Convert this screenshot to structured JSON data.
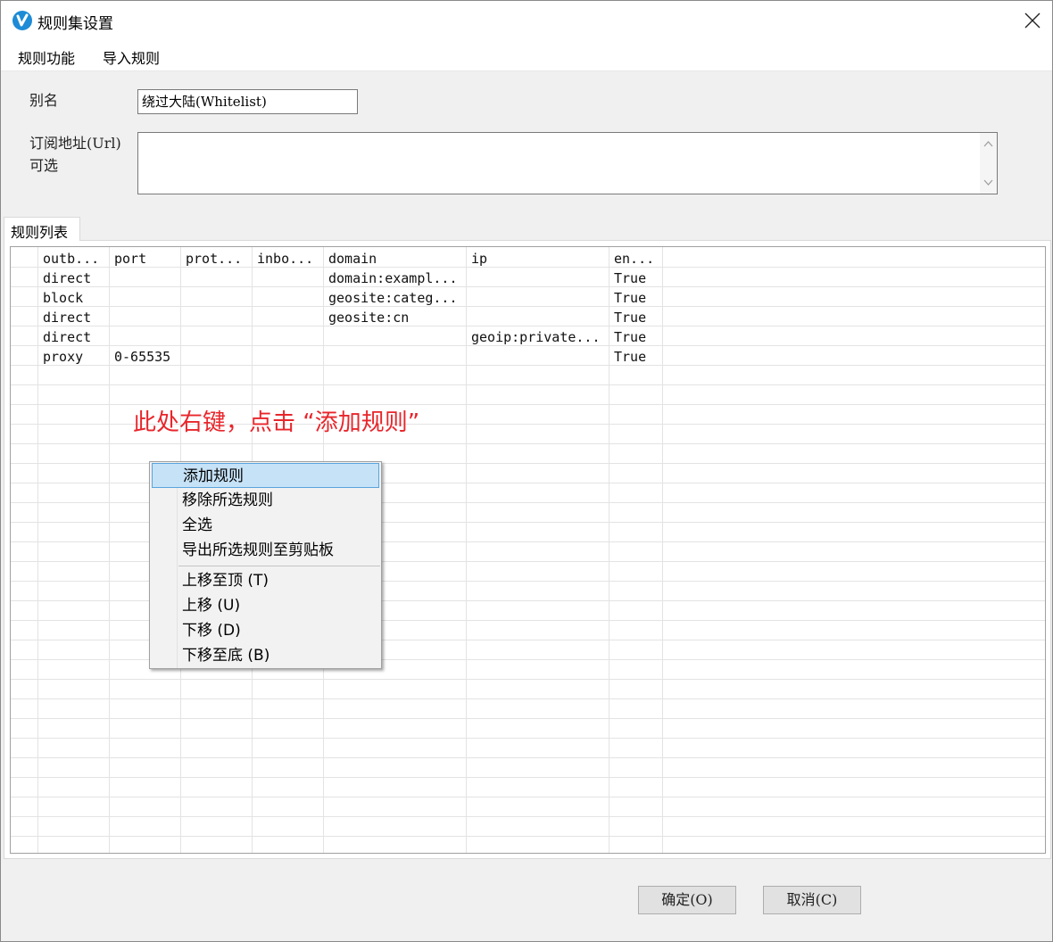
{
  "window": {
    "title": "规则集设置"
  },
  "menubar": {
    "items": [
      "规则功能",
      "导入规则"
    ]
  },
  "form": {
    "alias_label": "别名",
    "alias_value": "绕过大陆(Whitelist)",
    "url_label_line1": "订阅地址(Url)",
    "url_label_line2": "可选",
    "url_value": ""
  },
  "tab": {
    "label": "规则列表"
  },
  "grid": {
    "columns": [
      "outb...",
      "port",
      "prot...",
      "inbo...",
      "domain",
      "ip",
      "en..."
    ],
    "rows": [
      [
        "direct",
        "",
        "",
        "",
        "domain:exampl...",
        "",
        "True"
      ],
      [
        "block",
        "",
        "",
        "",
        "geosite:categ...",
        "",
        "True"
      ],
      [
        "direct",
        "",
        "",
        "",
        "geosite:cn",
        "",
        "True"
      ],
      [
        "direct",
        "",
        "",
        "",
        "",
        "geoip:private...",
        "True"
      ],
      [
        "proxy",
        "0-65535",
        "",
        "",
        "",
        "",
        "True"
      ]
    ]
  },
  "annotation": {
    "text": "此处右键，点击 “添加规则”",
    "color": "#e8262b"
  },
  "context_menu": {
    "items": [
      "添加规则",
      "移除所选规则",
      "全选",
      "导出所选规则至剪贴板",
      "上移至顶 (T)",
      "上移 (U)",
      "下移 (D)",
      "下移至底 (B)"
    ],
    "highlighted": "添加规则"
  },
  "buttons": {
    "ok": "确定(O)",
    "cancel": "取消(C)"
  },
  "icons": {
    "app": "v2rayn-app-icon",
    "close": "close-icon"
  }
}
